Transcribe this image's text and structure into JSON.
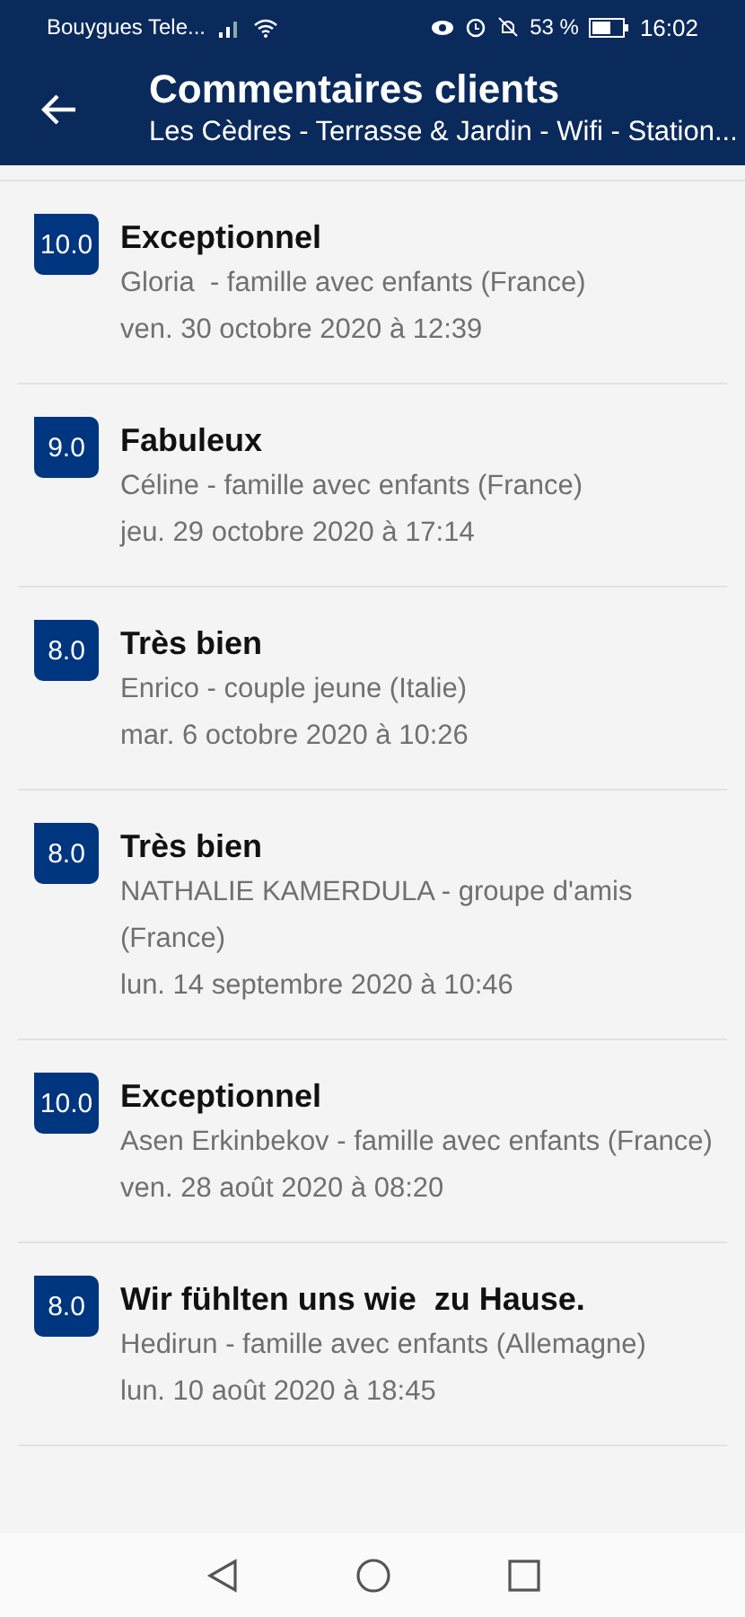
{
  "status_bar": {
    "carrier": "Bouygues Tele...",
    "battery_text": "53 %",
    "time": "16:02"
  },
  "app_bar": {
    "title": "Commentaires clients",
    "subtitle": "Les Cèdres - Terrasse & Jardin - Wifi - Station..."
  },
  "reviews": [
    {
      "score": "10.0",
      "title": "Exceptionnel",
      "author": "Gloria  - famille avec enfants (France)",
      "date": "ven. 30 octobre 2020 à 12:39"
    },
    {
      "score": "9.0",
      "title": "Fabuleux",
      "author": "Céline - famille avec enfants (France)",
      "date": "jeu. 29 octobre 2020 à 17:14"
    },
    {
      "score": "8.0",
      "title": "Très bien",
      "author": "Enrico - couple jeune (Italie)",
      "date": "mar. 6 octobre 2020 à 10:26"
    },
    {
      "score": "8.0",
      "title": "Très bien",
      "author": "NATHALIE KAMERDULA - groupe d'amis (France)",
      "date": "lun. 14 septembre 2020 à 10:46"
    },
    {
      "score": "10.0",
      "title": "Exceptionnel",
      "author": "Asen Erkinbekov - famille avec enfants (France)",
      "date": "ven. 28 août 2020 à 08:20"
    },
    {
      "score": "8.0",
      "title": "Wir fühlten uns wie  zu Hause.",
      "author": "Hedirun - famille avec enfants (Allemagne)",
      "date": "lun. 10 août 2020 à 18:45"
    }
  ]
}
